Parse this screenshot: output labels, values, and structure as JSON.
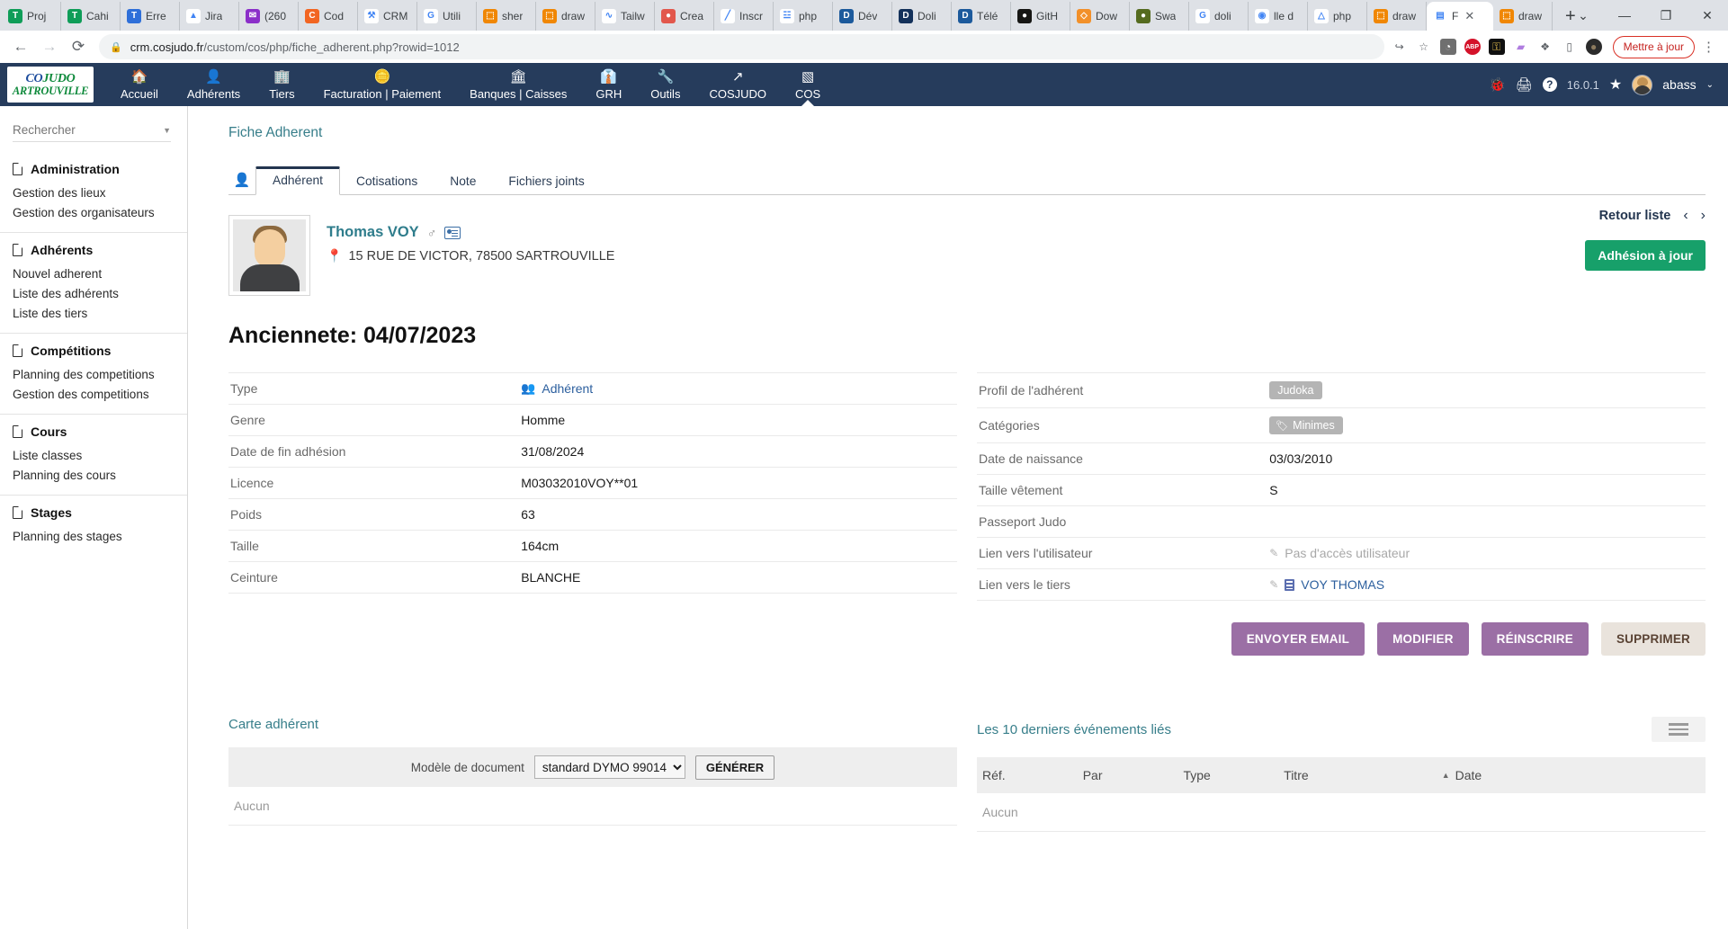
{
  "browser": {
    "tabs": [
      {
        "label": "Proj",
        "icon": "trello-icon",
        "color": "#0f9d58",
        "glyph": "T"
      },
      {
        "label": "Cahi",
        "icon": "trello-icon",
        "color": "#0f9d58",
        "glyph": "T"
      },
      {
        "label": "Erre",
        "icon": "trello-icon",
        "color": "#2e6fd9",
        "glyph": "T"
      },
      {
        "label": "Jira",
        "icon": "jira-icon",
        "color": "#ffffff",
        "glyph": "▲"
      },
      {
        "label": "(260",
        "icon": "mail-icon",
        "color": "#8b2fc9",
        "glyph": "✉"
      },
      {
        "label": "Cod",
        "icon": "code-icon",
        "color": "#f26522",
        "glyph": "C"
      },
      {
        "label": "CRM",
        "icon": "crm-icon",
        "color": "#ffffff",
        "glyph": "⚒"
      },
      {
        "label": "Utili",
        "icon": "google-icon",
        "color": "#ffffff",
        "glyph": "G"
      },
      {
        "label": "sher",
        "icon": "drawio-icon",
        "color": "#f08705",
        "glyph": "⬚"
      },
      {
        "label": "draw",
        "icon": "drawio-icon",
        "color": "#f08705",
        "glyph": "⬚"
      },
      {
        "label": "Tailw",
        "icon": "tailwind-icon",
        "color": "#ffffff",
        "glyph": "∿"
      },
      {
        "label": "Crea",
        "icon": "creative-icon",
        "color": "#e2574c",
        "glyph": "●"
      },
      {
        "label": "Inscr",
        "icon": "pen-icon",
        "color": "#ffffff",
        "glyph": "╱"
      },
      {
        "label": "php",
        "icon": "phpmyadmin-icon",
        "color": "#ffffff",
        "glyph": "☳"
      },
      {
        "label": "Dév",
        "icon": "dolibarr-icon",
        "color": "#1c5a9c",
        "glyph": "D"
      },
      {
        "label": "Doli",
        "icon": "dolibarr-icon",
        "color": "#13315a",
        "glyph": "D"
      },
      {
        "label": "Télé",
        "icon": "dolibarr-icon",
        "color": "#1c5a9c",
        "glyph": "D"
      },
      {
        "label": "GitH",
        "icon": "github-icon",
        "color": "#161614",
        "glyph": "●"
      },
      {
        "label": "Dow",
        "icon": "diamond-icon",
        "color": "#f2902a",
        "glyph": "◇"
      },
      {
        "label": "Swa",
        "icon": "swagger-icon",
        "color": "#556b1f",
        "glyph": "●"
      },
      {
        "label": "doli",
        "icon": "google-icon",
        "color": "#ffffff",
        "glyph": "G"
      },
      {
        "label": "lle d",
        "icon": "maps-icon",
        "color": "#ffffff",
        "glyph": "◉"
      },
      {
        "label": "php",
        "icon": "drive-icon",
        "color": "#ffffff",
        "glyph": "△"
      },
      {
        "label": "draw",
        "icon": "drawio-icon",
        "color": "#f08705",
        "glyph": "⬚"
      },
      {
        "label": "F",
        "icon": "cosjudo-icon",
        "color": "#ffffff",
        "glyph": "▤",
        "active": true
      },
      {
        "label": "draw",
        "icon": "drawio-icon",
        "color": "#f08705",
        "glyph": "⬚"
      }
    ],
    "new_tab_label": "+",
    "tab_search_label": "⌄",
    "window_controls": [
      "—",
      "❐",
      "✕"
    ],
    "back_label": "←",
    "forward_label": "→",
    "reload_label": "⟳",
    "lock_label": "🔒",
    "url_host": "crm.cosjudo.fr",
    "url_path": "/custom/cos/php/fiche_adherent.php?rowid=1012",
    "extensions": [
      {
        "name": "share-icon",
        "glyph": "↪",
        "bg": "transparent",
        "fg": "#5f6368"
      },
      {
        "name": "bookmark-star-icon",
        "glyph": "☆",
        "bg": "transparent",
        "fg": "#5f6368"
      },
      {
        "name": "shield-extension-icon",
        "glyph": "◔",
        "bg": "#6f6f6f",
        "fg": "#ffffff"
      },
      {
        "name": "adblock-extension-icon",
        "glyph": "ABP",
        "bg": "#d4122a",
        "fg": "#ffffff"
      },
      {
        "name": "keepass-extension-icon",
        "glyph": "⚿",
        "bg": "#101010",
        "fg": "#d8b44a"
      },
      {
        "name": "colorzilla-extension-icon",
        "glyph": "▰",
        "bg": "transparent",
        "fg": "#b07de0"
      },
      {
        "name": "extensions-puzzle-icon",
        "glyph": "❖",
        "bg": "transparent",
        "fg": "#5f6368"
      },
      {
        "name": "sidepanel-icon",
        "glyph": "▯",
        "bg": "transparent",
        "fg": "#5f6368"
      },
      {
        "name": "profile-avatar-icon",
        "glyph": "●",
        "bg": "#2b2b2b",
        "fg": "#8c7a5e"
      }
    ],
    "update_label": "Mettre à jour",
    "menu_label": "⋮"
  },
  "navbar": {
    "brand_line1": "CO",
    "brand_line1b": "JUDO",
    "brand_line2": "ARTROUVILLE",
    "items": [
      {
        "label": "Accueil",
        "icon": "home-icon",
        "glyph": "🏠",
        "active": false
      },
      {
        "label": "Adhérents",
        "icon": "user-icon",
        "glyph": "👤",
        "active": false
      },
      {
        "label": "Tiers",
        "icon": "building-icon",
        "glyph": "🏢",
        "active": false
      },
      {
        "label": "Facturation | Paiement",
        "icon": "coins-icon",
        "glyph": "🪙",
        "active": false
      },
      {
        "label": "Banques | Caisses",
        "icon": "bank-icon",
        "glyph": "🏛",
        "active": false
      },
      {
        "label": "GRH",
        "icon": "employee-icon",
        "glyph": "👔",
        "active": false
      },
      {
        "label": "Outils",
        "icon": "wrench-icon",
        "glyph": "🔧",
        "active": false
      },
      {
        "label": "COSJUDO",
        "icon": "external-link-icon",
        "glyph": "↗",
        "active": false
      },
      {
        "label": "COS",
        "icon": "page-icon",
        "glyph": "▧",
        "active": true
      }
    ],
    "right": {
      "bug_icon": "bug-icon",
      "bug_glyph": "🐞",
      "print_icon": "print-icon",
      "print_glyph": "🖨",
      "help_icon": "help-circle-icon",
      "help_glyph": "?",
      "version": "16.0.1",
      "star_icon": "star-icon",
      "star_glyph": "★",
      "username": "abass",
      "caret": "⌄"
    }
  },
  "sidebar": {
    "search_placeholder": "Rechercher",
    "search_value": "",
    "groups": [
      {
        "title": "Administration",
        "links": [
          "Gestion des lieux",
          "Gestion des organisateurs"
        ]
      },
      {
        "title": "Adhérents",
        "links": [
          "Nouvel adherent",
          "Liste des adhérents",
          "Liste des tiers"
        ]
      },
      {
        "title": "Compétitions",
        "links": [
          "Planning des competitions",
          "Gestion des competitions"
        ]
      },
      {
        "title": "Cours",
        "links": [
          "Liste classes",
          "Planning des cours"
        ]
      },
      {
        "title": "Stages",
        "links": [
          "Planning des stages"
        ]
      }
    ]
  },
  "main": {
    "page_title": "Fiche Adherent",
    "tabs": [
      {
        "label": "Adhérent",
        "active": true
      },
      {
        "label": "Cotisations",
        "active": false
      },
      {
        "label": "Note",
        "active": false
      },
      {
        "label": "Fichiers joints",
        "active": false
      }
    ],
    "hero": {
      "name": "Thomas VOY",
      "gender_symbol": "♂",
      "vcard_icon": "vcard-icon",
      "address": "15 RUE DE VICTOR, 78500 SARTROUVILLE",
      "pin_icon": "map-pin-icon"
    },
    "retour": {
      "label": "Retour liste",
      "prev": "‹",
      "next": "›",
      "adhesion_button": "Adhésion à jour"
    },
    "anciennete": "Anciennete: 04/07/2023",
    "left_fields": [
      {
        "label": "Type",
        "value": "Adhérent",
        "style": "link-group"
      },
      {
        "label": "Genre",
        "value": "Homme",
        "style": "plain"
      },
      {
        "label": "Date de fin adhésion",
        "value": "31/08/2024",
        "style": "plain"
      },
      {
        "label": "Licence",
        "value": "M03032010VOY**01",
        "style": "plain"
      },
      {
        "label": "Poids",
        "value": "63",
        "style": "plain"
      },
      {
        "label": "Taille",
        "value": "164cm",
        "style": "plain"
      },
      {
        "label": "Ceinture",
        "value": "BLANCHE",
        "style": "plain"
      }
    ],
    "right_fields": [
      {
        "label": "Profil de l'adhérent",
        "value": "Judoka",
        "style": "badge"
      },
      {
        "label": "Catégories",
        "value": "Minimes",
        "style": "tag"
      },
      {
        "label": "Date de naissance",
        "value": "03/03/2010",
        "style": "plain"
      },
      {
        "label": "Taille vêtement",
        "value": "S",
        "style": "plain"
      },
      {
        "label": "Passeport Judo",
        "value": "",
        "style": "plain"
      },
      {
        "label": "Lien vers l'utilisateur",
        "value": "Pas d'accès utilisateur",
        "style": "pencil-muted"
      },
      {
        "label": "Lien vers le tiers",
        "value": "VOY THOMAS",
        "style": "pencil-link"
      }
    ],
    "actions": [
      {
        "label": "ENVOYER EMAIL",
        "variant": "primary"
      },
      {
        "label": "MODIFIER",
        "variant": "primary"
      },
      {
        "label": "RÉINSCRIRE",
        "variant": "primary"
      },
      {
        "label": "SUPPRIMER",
        "variant": "ghost"
      }
    ],
    "card_section": {
      "title": "Carte adhérent",
      "doc_model_label": "Modèle de document",
      "doc_model_value": "standard DYMO 99014 ...",
      "doc_model_options": [
        "standard DYMO 99014 ..."
      ],
      "generate_label": "GÉNÉRER",
      "empty_label": "Aucun"
    },
    "events_section": {
      "title": "Les 10 derniers événements liés",
      "menu_icon": "hamburger-icon",
      "columns": [
        "Réf.",
        "Par",
        "Type",
        "Titre",
        "Date"
      ],
      "sort_column": "Date",
      "sort_caret": "▲",
      "empty_label": "Aucun"
    }
  }
}
